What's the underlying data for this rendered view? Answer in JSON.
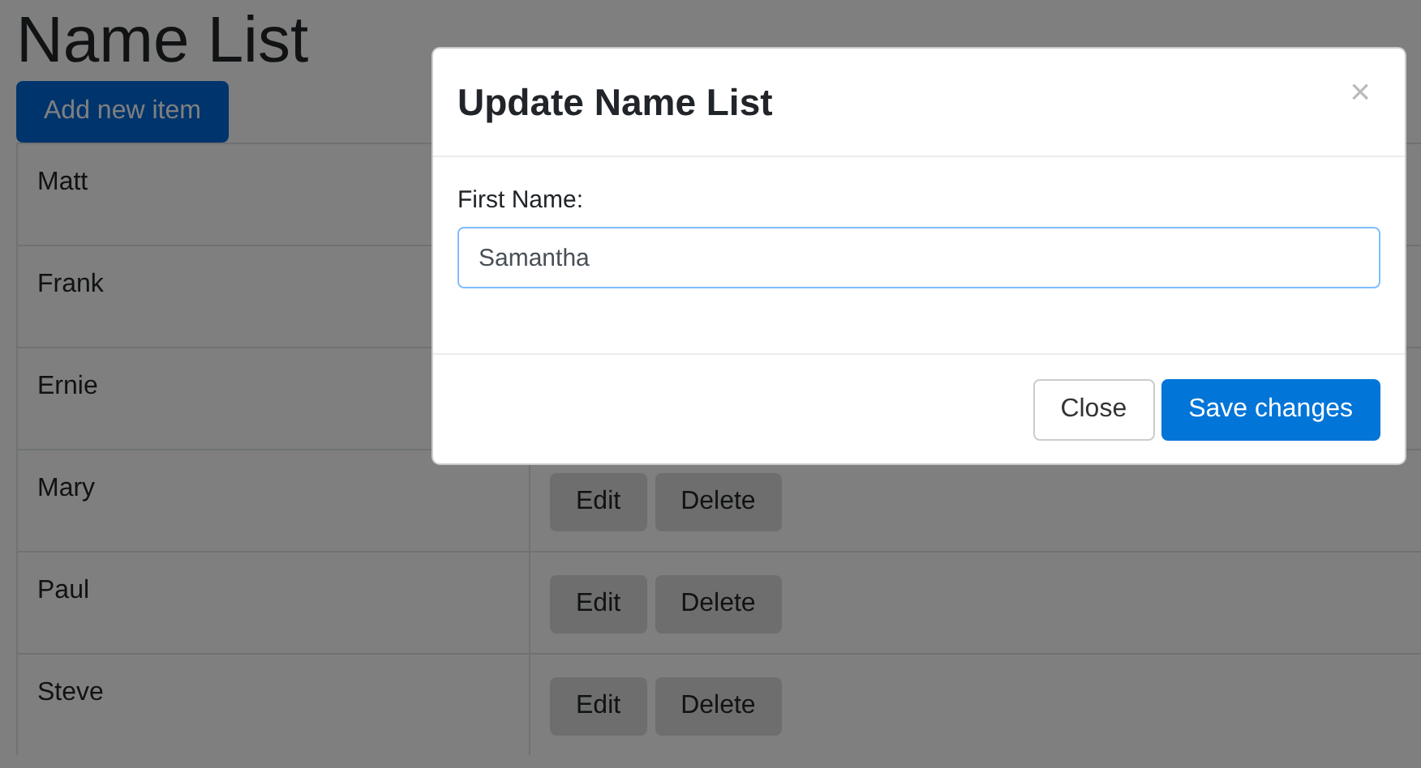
{
  "page": {
    "title": "Name List",
    "add_button": "Add new item"
  },
  "rows": [
    {
      "name": "Matt",
      "actions": []
    },
    {
      "name": "Frank",
      "actions": []
    },
    {
      "name": "Ernie",
      "actions": []
    },
    {
      "name": "Mary",
      "actions": [
        "Edit",
        "Delete"
      ]
    },
    {
      "name": "Paul",
      "actions": [
        "Edit",
        "Delete"
      ]
    },
    {
      "name": "Steve",
      "actions": [
        "Edit",
        "Delete"
      ]
    }
  ],
  "modal": {
    "title": "Update Name List",
    "close_icon": "×",
    "field_label": "First Name:",
    "field_value": "Samantha",
    "buttons": [
      {
        "label": "Close",
        "kind": "secondary"
      },
      {
        "label": "Save changes",
        "kind": "primary"
      }
    ]
  }
}
